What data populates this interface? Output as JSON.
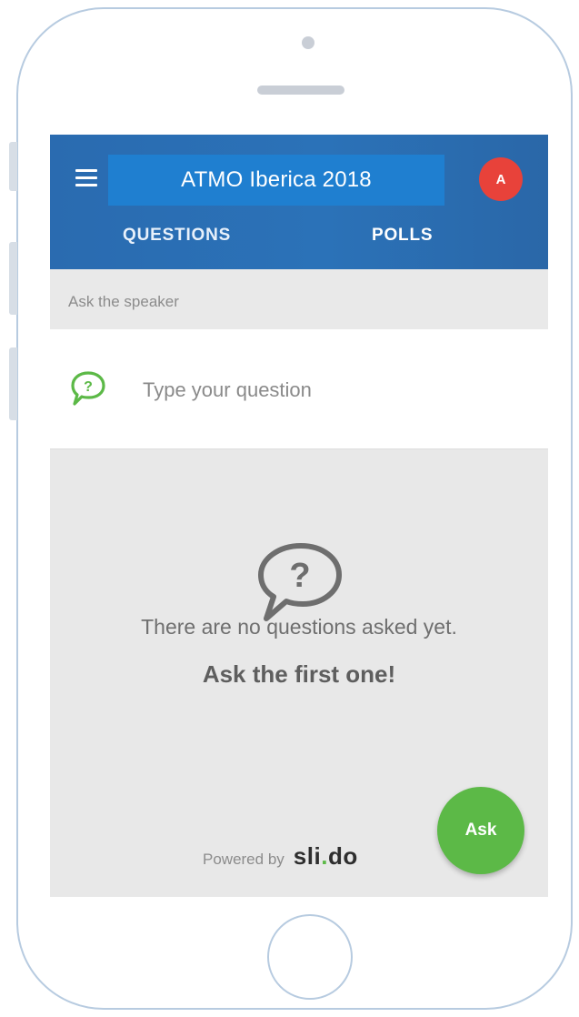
{
  "app": {
    "title": "ATMO Iberica 2018",
    "avatar_initial": "A"
  },
  "tabs": [
    {
      "label": "QUESTIONS"
    },
    {
      "label": "POLLS"
    }
  ],
  "ask_section": {
    "label": "Ask the speaker",
    "input_placeholder": "Type your question"
  },
  "empty_state": {
    "line1": "There are no questions asked yet.",
    "line2": "Ask the first one!"
  },
  "footer": {
    "powered_by": "Powered by",
    "brand_prefix": "sli",
    "brand_dot": ".",
    "brand_suffix": "do"
  },
  "fab": {
    "label": "Ask"
  },
  "colors": {
    "appbar": "#2b72b8",
    "avatar": "#e8423a",
    "accent_green": "#5cb947"
  },
  "icons": [
    "hamburger-menu-icon",
    "question-bubble-icon"
  ]
}
